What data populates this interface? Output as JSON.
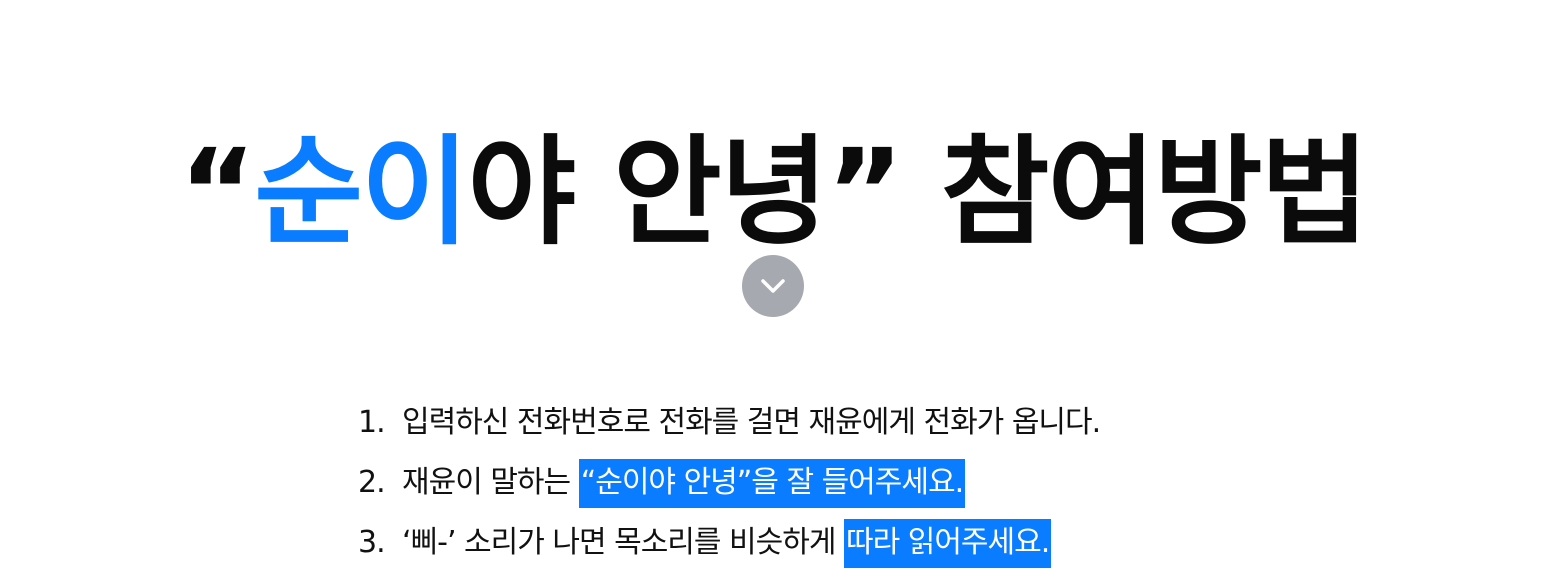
{
  "title": {
    "open_quote": "“",
    "accent": "순이",
    "rest": "야 안녕",
    "close_quote": "”",
    "suffix": " 참여방법"
  },
  "toggle": {
    "icon": "chevron-down-icon",
    "color": "#a6aab0"
  },
  "colors": {
    "accent": "#0a7cff",
    "text": "#111111"
  },
  "steps": [
    {
      "num": "1.",
      "text": "입력하신 전화번호로 전화를 걸면 재윤에게 전화가 옵니다.",
      "highlight": ""
    },
    {
      "num": "2.",
      "text": "재윤이 말하는 ",
      "highlight": "“순이야 안녕”을 잘 들어주세요."
    },
    {
      "num": "3.",
      "text": "‘삐-’ 소리가 나면 목소리를 비슷하게 ",
      "highlight": "따라 읽어주세요."
    }
  ]
}
